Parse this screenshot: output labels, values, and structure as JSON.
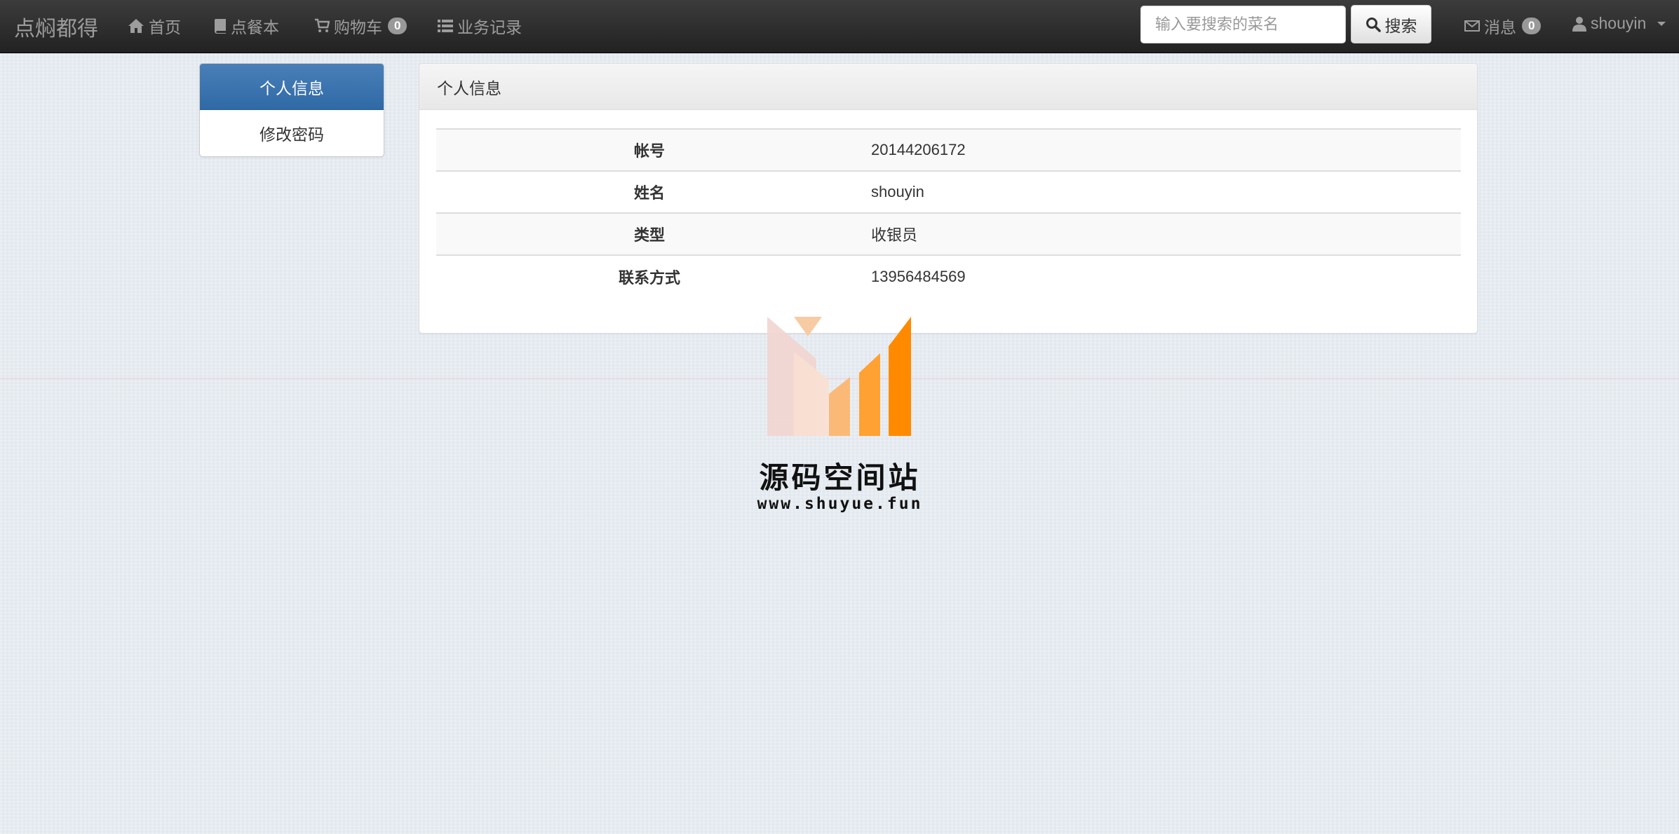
{
  "navbar": {
    "brand": "点焖都得",
    "links": {
      "home": "首页",
      "menu": "点餐本",
      "cart": "购物车",
      "cart_count": "0",
      "records": "业务记录"
    },
    "search": {
      "placeholder": "输入要搜索的菜名",
      "button_label": "搜索"
    },
    "messages": {
      "label": "消息",
      "count": "0"
    },
    "user": "shouyin"
  },
  "sidebar": {
    "items": [
      {
        "label": "个人信息",
        "active": true
      },
      {
        "label": "修改密码",
        "active": false
      }
    ]
  },
  "panel": {
    "title": "个人信息",
    "rows": [
      {
        "key": "帐号",
        "value": "20144206172"
      },
      {
        "key": "姓名",
        "value": "shouyin"
      },
      {
        "key": "类型",
        "value": "收银员"
      },
      {
        "key": "联系方式",
        "value": "13956484569"
      }
    ]
  },
  "watermark": {
    "title": "源码空间站",
    "url": "www.shuyue.fun",
    "colors": {
      "orange": "#ff8a00",
      "peach": "#f7cba3",
      "pink": "#f2d5d0"
    }
  },
  "icons": [
    "home-icon",
    "book-icon",
    "cart-icon",
    "list-icon",
    "search-icon",
    "envelope-icon",
    "user-icon",
    "caret-down-icon"
  ]
}
